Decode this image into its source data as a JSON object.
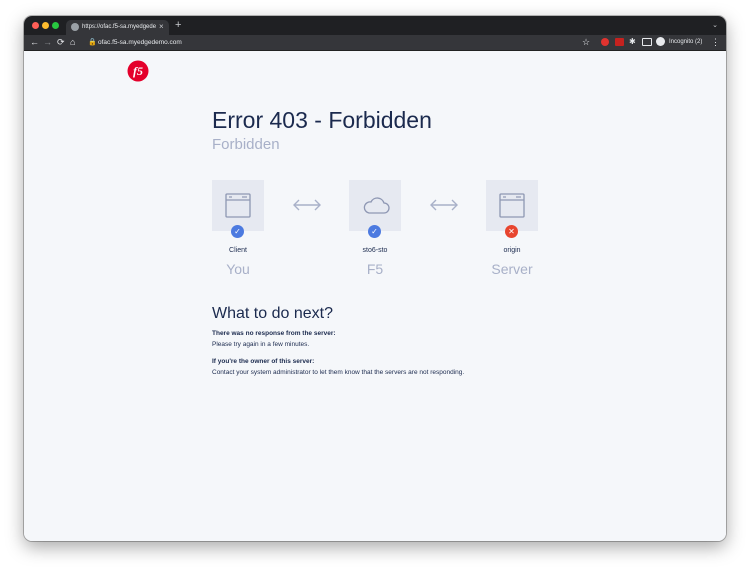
{
  "browser": {
    "tab_title": "https://ofac.f5-sa.myedgedemo.c",
    "tab_close": "×",
    "new_tab": "+",
    "tab_menu": "⌄",
    "url": "ofac.f5-sa.myedgedemo.com",
    "incognito_label": "Incognito (2)",
    "nav": {
      "back": "←",
      "forward": "→",
      "reload": "⟳",
      "home": "⌂"
    },
    "icons": {
      "lock": "🔒",
      "star": "☆",
      "puzzle": "✱",
      "menu": "⋮"
    }
  },
  "page": {
    "title": "Error 403 - Forbidden",
    "subtitle": "Forbidden",
    "nodes": [
      {
        "label": "Client",
        "role": "You",
        "status": "ok",
        "status_icon": "✓",
        "icon": "browser-window-icon"
      },
      {
        "label": "sto6-sto",
        "role": "F5",
        "status": "ok",
        "status_icon": "✓",
        "icon": "cloud-icon"
      },
      {
        "label": "origin",
        "role": "Server",
        "status": "error",
        "status_icon": "✕",
        "icon": "server-window-icon"
      }
    ],
    "next_title": "What to do next?",
    "no_response_heading": "There was no response from the server:",
    "no_response_text": "Please try again in a few minutes.",
    "owner_heading": "If you're the owner of this server:",
    "owner_text": "Contact your system administrator to let them know that the servers are not responding."
  },
  "colors": {
    "brand_red": "#e4002b",
    "ok_blue": "#4c7ae0",
    "error_red": "#e8452f",
    "navy": "#1b2a4e",
    "muted": "#a8b0c8"
  }
}
